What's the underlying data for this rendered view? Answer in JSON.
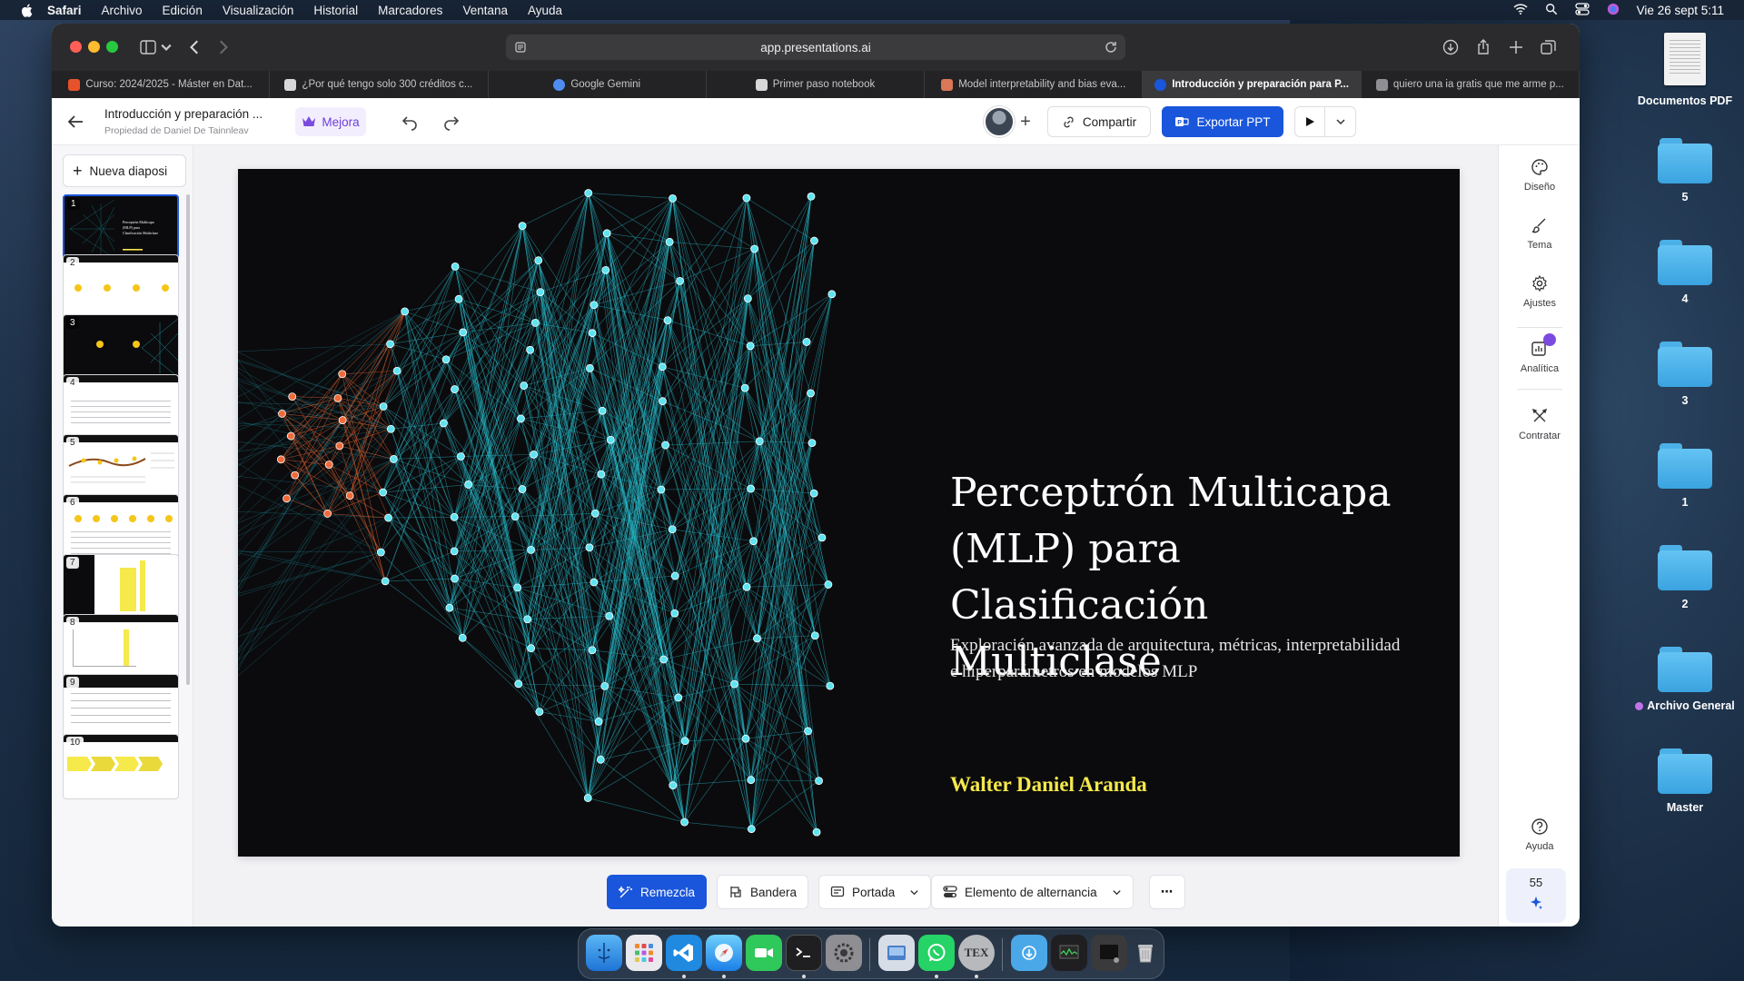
{
  "menubar": {
    "app": "Safari",
    "items": [
      "Archivo",
      "Edición",
      "Visualización",
      "Historial",
      "Marcadores",
      "Ventana",
      "Ayuda"
    ],
    "clock": "Vie 26 sept 5:11"
  },
  "browser": {
    "url": "app.presentations.ai",
    "tabs": [
      {
        "label": "Curso: 2024/2025 - Máster en Dat...",
        "favicon_color": "#e8522a"
      },
      {
        "label": "¿Por qué tengo solo 300 créditos c...",
        "favicon_color": "#ffffff"
      },
      {
        "label": "Google Gemini",
        "favicon_color": "#4e8cf0"
      },
      {
        "label": "Primer paso notebook",
        "favicon_color": "#ffffff"
      },
      {
        "label": "Model interpretability and bias eva...",
        "favicon_color": "#d97757"
      },
      {
        "label": "Introducción y preparación para P...",
        "favicon_color": "#1a56db",
        "active": true
      },
      {
        "label": "quiero una ia gratis que me arme p...",
        "favicon_color": "#8e8e93"
      }
    ]
  },
  "header": {
    "doc_title": "Introducción y preparación ...",
    "doc_owner": "Propiedad de Daniel De Tainnleav",
    "mejora_label": "Mejora",
    "share_label": "Compartir",
    "export_label": "Exportar PPT"
  },
  "sidebar": {
    "new_slide_label": "Nueva diaposi",
    "slides": [
      {
        "num": "1"
      },
      {
        "num": "2"
      },
      {
        "num": "3"
      },
      {
        "num": "4"
      },
      {
        "num": "5"
      },
      {
        "num": "6"
      },
      {
        "num": "7"
      },
      {
        "num": "8"
      },
      {
        "num": "9"
      },
      {
        "num": "10"
      }
    ]
  },
  "slide": {
    "title": "Perceptrón Multicapa (MLP) para Clasificación Multiclase",
    "subtitle": "Exploración avanzada de arquitectura, métricas, interpretabilidad e hiperparámetros en modelos MLP",
    "author": "Walter Daniel Aranda"
  },
  "bottom_tools": {
    "remix_label": "Remezcla",
    "flag_label": "Bandera",
    "cover_label": "Portada",
    "toggle_label": "Elemento de alternancia"
  },
  "right_rail": {
    "items": [
      "Diseño",
      "Tema",
      "Ajustes",
      "Analítica",
      "Contratar"
    ],
    "help_label": "Ayuda",
    "credits": "55"
  },
  "desktop": {
    "items": [
      "Documentos PDF",
      "5",
      "4",
      "3",
      "1",
      "2",
      "Archivo General",
      "Master"
    ]
  },
  "dock": {
    "apps": [
      "finder-icon",
      "launchpad-icon",
      "vscode-icon",
      "safari-icon",
      "facetime-icon",
      "terminal-icon",
      "settings-icon",
      "preview-icon",
      "whatsapp-icon",
      "tex-icon",
      "downloads-icon",
      "activity-icon",
      "screen-icon",
      "trash-icon"
    ],
    "tex_label": "TEX"
  }
}
